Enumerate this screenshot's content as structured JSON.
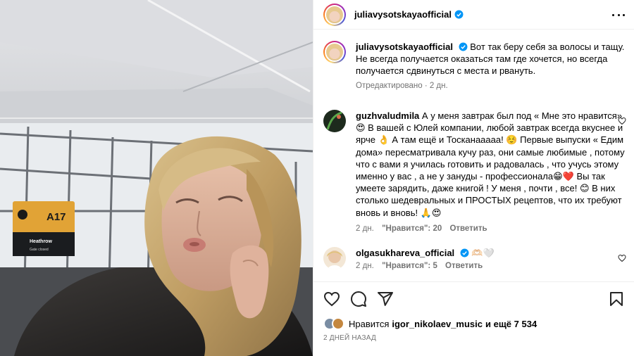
{
  "post": {
    "author": "juliavysotskaya official",
    "author_handle": "juliavysotskayaofficial",
    "photo_sign": {
      "gate": "A17",
      "destination": "Heathrow",
      "status": "Gate closed"
    }
  },
  "caption": {
    "text": "Вот так беру себя за волосы и тащу. Не всегда получается оказаться там где хочется, но всегда получается сдвинуться с места и рвануть.",
    "time": "Отредактировано · 2 дн."
  },
  "comments": [
    {
      "user": "guzhvaludmila",
      "text": "А у меня завтрак был под « Мне это нравится» 😍 В вашей с Юлей компании, любой завтрак всегда вкуснее и ярче 👌 А там ещё и Тосканааааа! ☺️ Первые выпуски « Едим дома» пересматривала кучу раз, они самые любимые , потому что с вами я училась готовить и радовалась , что учусь этому именно у вас , а не у зануды - профессионала😁❤️ Вы так умеете зарядить, даже книгой ! У меня , почти , все! 😊 В них столько шедевральных и ПРОСТЫХ рецептов, что их требуют вновь и вновь! 🙏😍",
      "age": "2 дн.",
      "likes_label": "\"Нравится\": 20",
      "reply_label": "Ответить"
    },
    {
      "user": "olgasukhareva_official",
      "text": "🫶🏻🤍",
      "age": "2 дн.",
      "likes_label": "\"Нравится\": 5",
      "reply_label": "Ответить"
    }
  ],
  "likes": {
    "prefix": "Нравится",
    "user": "igor_nikolaev_music",
    "suffix": "и ещё 7 534"
  },
  "date": "2 ДНЕЙ НАЗАД",
  "icons": {
    "like": "heart-icon",
    "comment": "comment-icon",
    "share": "share-icon",
    "save": "bookmark-icon",
    "more": "more-icon"
  },
  "colors": {
    "verified": "#0095f6",
    "meta": "#737373",
    "border": "#efefef"
  }
}
